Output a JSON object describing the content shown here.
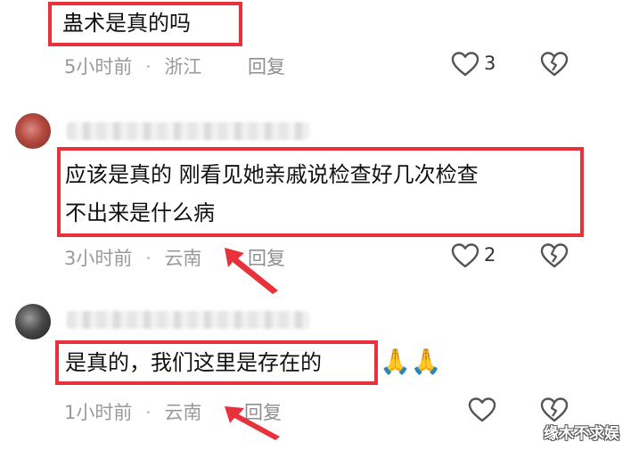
{
  "comments": [
    {
      "text": "蛊术是真的吗",
      "time": "5小时前",
      "location": "浙江",
      "reply": "回复",
      "likes": "3"
    },
    {
      "text_line1": "应该是真的 刚看见她亲戚说检查好几次检查",
      "text_line2": "不出来是什么病",
      "time": "3小时前",
      "location": "云南",
      "reply": "回复",
      "likes": "2"
    },
    {
      "text": "是真的，我们这里是存在的",
      "time": "1小时前",
      "location": "云南",
      "reply": "回复"
    }
  ],
  "separator": "·",
  "emoji": "🙏🙏",
  "watermark": "缘木不求娱",
  "colors": {
    "highlight": "#e8313a",
    "meta": "#9a9a9a"
  },
  "icons": [
    "heart-outline-icon",
    "broken-heart-icon",
    "red-arrow-annotation"
  ]
}
